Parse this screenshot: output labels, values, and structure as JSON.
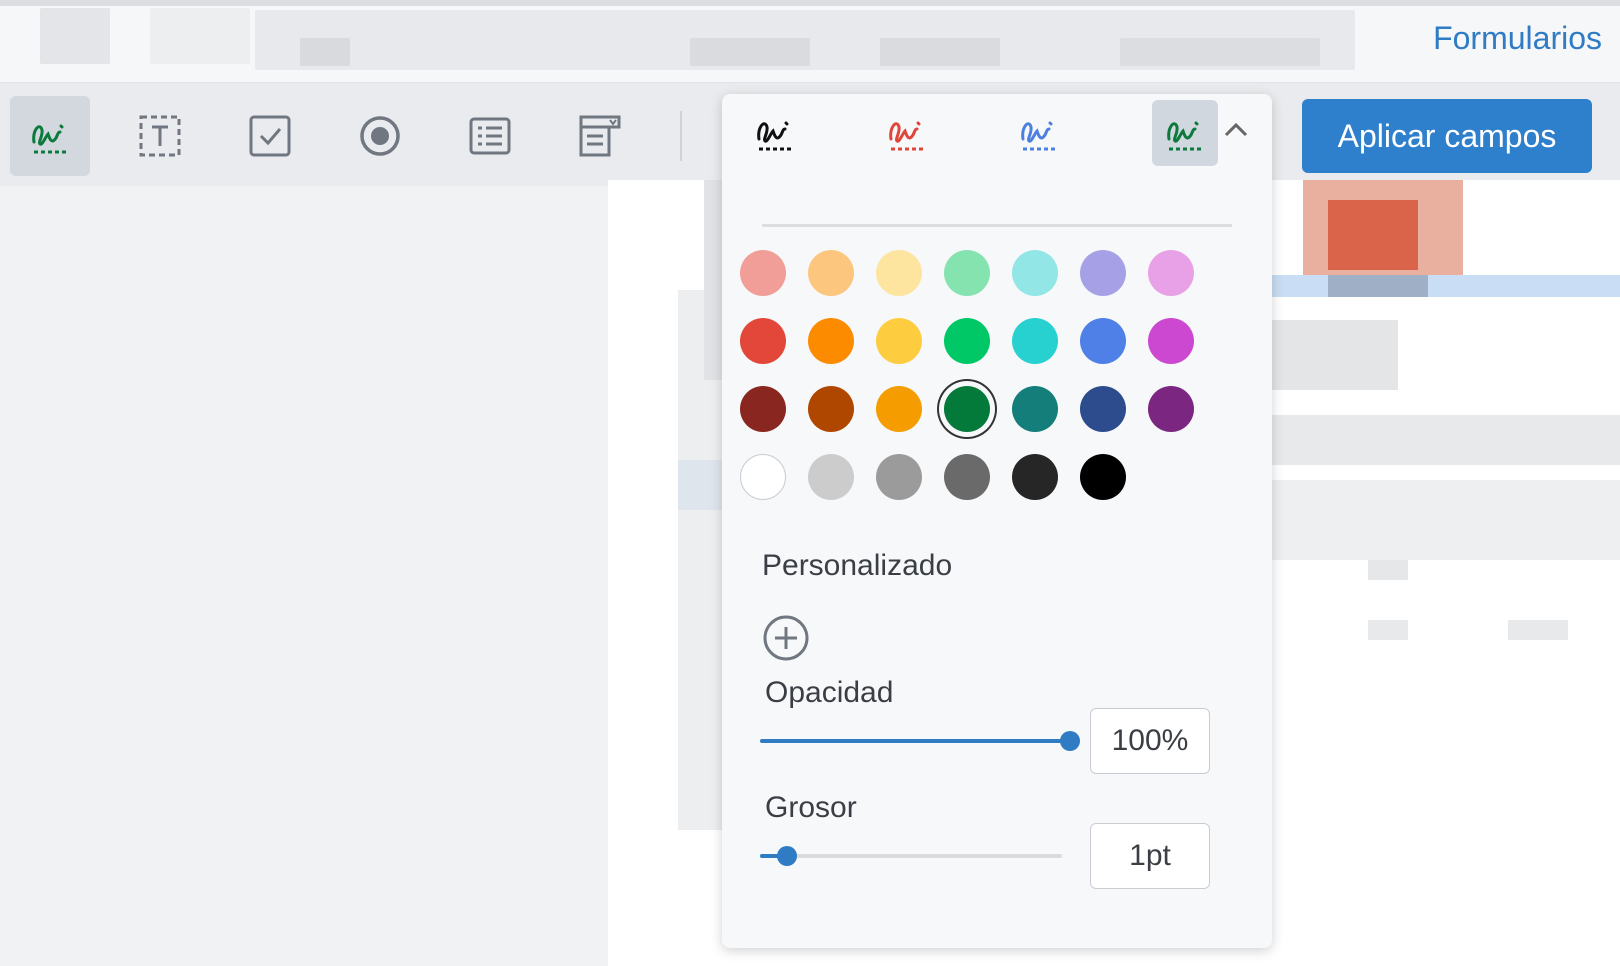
{
  "header": {
    "link_label": "Formularios"
  },
  "toolbar": {
    "tools": [
      {
        "name": "signature-tool",
        "icon": "signature-icon",
        "active": true
      },
      {
        "name": "text-field-tool",
        "icon": "text-field-icon",
        "active": false
      },
      {
        "name": "checkbox-tool",
        "icon": "checkbox-icon",
        "active": false
      },
      {
        "name": "radio-tool",
        "icon": "radio-button-icon",
        "active": false
      },
      {
        "name": "list-box-tool",
        "icon": "list-box-icon",
        "active": false
      },
      {
        "name": "dropdown-tool",
        "icon": "dropdown-field-icon",
        "active": false
      }
    ],
    "apply_label": "Aplicar campos"
  },
  "popover": {
    "signature_styles": [
      {
        "name": "signature-style-black",
        "color": "#111111",
        "active": false
      },
      {
        "name": "signature-style-red",
        "color": "#e0453a",
        "active": false
      },
      {
        "name": "signature-style-blue",
        "color": "#4d7fe0",
        "active": false
      },
      {
        "name": "signature-style-green",
        "color": "#0c7a3c",
        "active": true
      }
    ],
    "palette": [
      [
        "#f29e98",
        "#fdc67e",
        "#fde5a0",
        "#85e3b0",
        "#92e6e6",
        "#a6a1e6",
        "#e8a1e6"
      ],
      [
        "#e2473a",
        "#fd8b00",
        "#fecc3f",
        "#00c866",
        "#27d1d0",
        "#4f80e8",
        "#cc48d0"
      ],
      [
        "#8a2620",
        "#b04700",
        "#f59d00",
        "#037a3a",
        "#147e7b",
        "#2c4c8d",
        "#7b2782"
      ],
      [
        "#ffffff",
        "#cccccc",
        "#9b9b9b",
        "#6a6a6a",
        "#262626",
        "#000000"
      ]
    ],
    "selected_color": "#037a3a",
    "custom_label": "Personalizado",
    "opacity_label": "Opacidad",
    "opacity_value": "100%",
    "opacity_fraction": 1.0,
    "thickness_label": "Grosor",
    "thickness_value": "1pt",
    "thickness_fraction": 0.09
  }
}
